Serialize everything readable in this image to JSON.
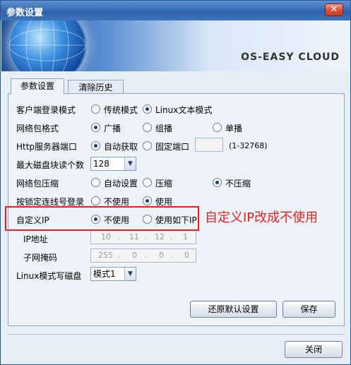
{
  "window": {
    "title": "参数设置",
    "close_glyph": "✕"
  },
  "banner": {
    "brand": "OS-EASY CLOUD"
  },
  "tabs": [
    {
      "label": "参数设置",
      "active": true
    },
    {
      "label": "清除历史",
      "active": false
    }
  ],
  "rows": {
    "login_mode": {
      "label": "客户端登录模式",
      "options": [
        "传统模式",
        "Linux文本模式"
      ],
      "selected": 1
    },
    "packet_format": {
      "label": "网络包格式",
      "options": [
        "广播",
        "组播",
        "单播"
      ],
      "selected": 0
    },
    "http_port": {
      "label": "Http服务器端口",
      "options": [
        "自动获取",
        "固定端口"
      ],
      "selected": 0,
      "port_value": "",
      "range_hint": "(1-32768)"
    },
    "max_block": {
      "label": "最大磁盘块读个数",
      "value": "128"
    },
    "compression": {
      "label": "网络包压缩",
      "options": [
        "自动设置",
        "压缩",
        "不压缩"
      ],
      "selected": 2
    },
    "lock_login": {
      "label": "按锁定连线号登录",
      "options": [
        "不使用",
        "使用"
      ],
      "selected": 1
    },
    "custom_ip": {
      "label": "自定义IP",
      "options": [
        "不使用",
        "使用如下IP"
      ],
      "selected": 0
    },
    "ip_address": {
      "label": "IP地址",
      "octets": [
        "10",
        "11",
        "12",
        "1"
      ]
    },
    "subnet_mask": {
      "label": "子网掩码",
      "octets": [
        "255",
        "0",
        "0",
        "0"
      ]
    },
    "linux_write": {
      "label": "Linux模式写磁盘",
      "value": "模式1"
    }
  },
  "buttons": {
    "restore_default": "还原默认设置",
    "save": "保存",
    "close": "关闭"
  },
  "annotation": {
    "text": "自定义IP改成不使用",
    "color": "#e0221d"
  },
  "colors": {
    "titlebar": "#3a6db5",
    "panel_bg": "#eef3fa",
    "annotation": "#e0221d"
  }
}
